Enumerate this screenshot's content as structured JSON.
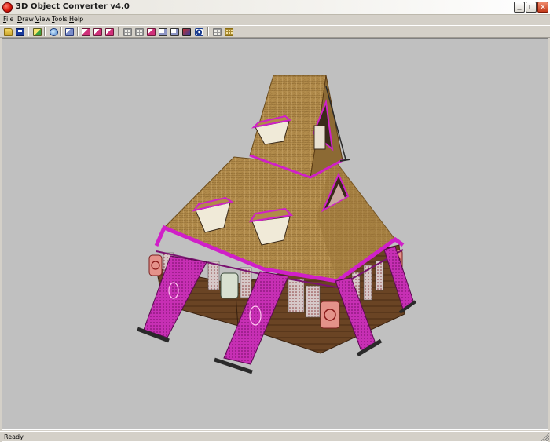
{
  "window": {
    "title": "3D Object Converter v4.0",
    "controls": {
      "minimize": "_",
      "maximize": "□",
      "close": "✕"
    }
  },
  "menu": {
    "items": [
      "File",
      "Draw",
      "View",
      "Tools",
      "Help"
    ]
  },
  "toolbar": {
    "buttons": [
      {
        "icon": "open-folder-icon"
      },
      {
        "icon": "save-disk-icon"
      },
      {
        "icon": "import-icon"
      },
      {
        "icon": "globe-icon"
      },
      {
        "icon": "cube-view-icon"
      },
      {
        "icon": "front-view-icon"
      },
      {
        "icon": "side-view-icon"
      },
      {
        "icon": "top-view-icon"
      },
      {
        "icon": "grid-icon"
      },
      {
        "icon": "grid-alt-icon"
      },
      {
        "icon": "bounding-box-icon"
      },
      {
        "icon": "box-icon"
      },
      {
        "icon": "wire-box-icon"
      },
      {
        "icon": "solid-render-icon"
      },
      {
        "icon": "mesh-render-icon"
      },
      {
        "icon": "texture-grid-icon"
      },
      {
        "icon": "texture-gold-icon"
      }
    ]
  },
  "viewport": {
    "background": "#c0c0c0",
    "model": {
      "roof_color": "#b08a4a",
      "trim_color": "#d020c8",
      "wall_color": "#6a4424"
    }
  },
  "status": {
    "text": "Ready"
  }
}
